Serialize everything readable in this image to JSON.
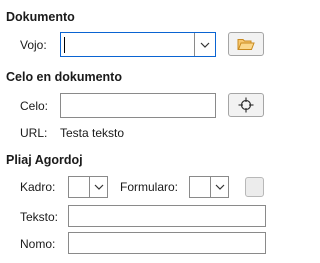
{
  "document_section": {
    "title": "Dokumento",
    "path_label": "Vojo:",
    "path_value": "",
    "browse_icon": "folder-open-icon"
  },
  "target_section": {
    "title": "Celo en dokumento",
    "target_label": "Celo:",
    "target_value": "",
    "target_icon": "crosshair-target-icon",
    "url_label": "URL:",
    "url_value": "Testa teksto"
  },
  "settings_section": {
    "title": "Pliaj Agordoj",
    "frame_label": "Kadro:",
    "frame_value": "",
    "form_label": "Formularo:",
    "form_value": "",
    "text_label": "Teksto:",
    "text_value": "",
    "name_label": "Nomo:",
    "name_value": ""
  },
  "colors": {
    "accent_focus": "#0a64d2",
    "folder_icon": "#e8a33d"
  }
}
